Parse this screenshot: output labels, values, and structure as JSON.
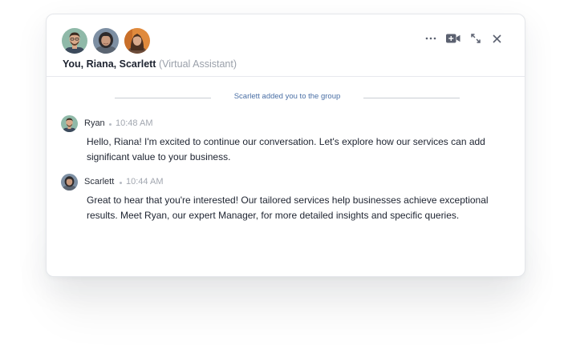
{
  "header": {
    "participants": "You, Riana, Scarlett",
    "role": "(Virtual Assistant)",
    "avatars": [
      {
        "name": "ryan-avatar-icon",
        "bg": "#8fb9a8",
        "skin": "#d9a98a",
        "hair": "#3b2a20",
        "shirt": "#3c4a5c"
      },
      {
        "name": "riana-avatar-icon",
        "bg": "#7d8fa3",
        "skin": "#c89a7e",
        "hair": "#2e2a2b",
        "shirt": "#5b6572"
      },
      {
        "name": "scarlett-avatar-icon",
        "bg": "#e08a3c",
        "skin": "#d8aa8c",
        "hair": "#4a3020",
        "shirt": "#6b4b3a"
      }
    ],
    "actions": [
      {
        "name": "more-options-icon"
      },
      {
        "name": "video-call-add-icon"
      },
      {
        "name": "expand-icon"
      },
      {
        "name": "close-icon"
      }
    ]
  },
  "system_message": "Scarlett added you to the group",
  "messages": [
    {
      "sender": "Ryan",
      "time": "10:48 AM",
      "text": "Hello, Riana! I'm excited to continue our conversation. Let's explore how our services can add significant value to your business."
    },
    {
      "sender": "Scarlett",
      "time": "10:44 AM",
      "text": "Great to hear that you're interested!  Our tailored services help businesses achieve exceptional results. Meet Ryan, our expert Manager, for more detailed insights and specific queries."
    }
  ],
  "colors": {
    "accent_text": "#4a6fa5",
    "primary_text": "#1d2330",
    "muted_text": "#9aa0aa",
    "border": "#e4e6ea"
  }
}
